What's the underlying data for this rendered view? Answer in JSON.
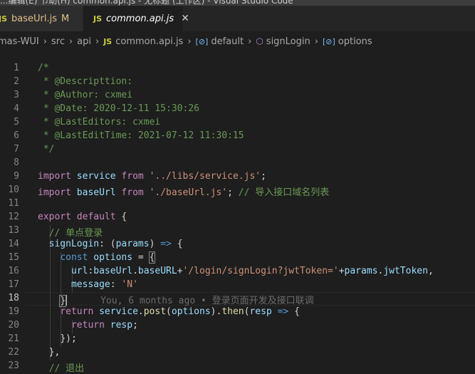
{
  "window": {
    "title_partial": "...编辑(E) 节助(H)    common.api.js - 无标题 (工作区) - Visual Studio Code"
  },
  "tabs": [
    {
      "icon": "JS",
      "label": "baseUrl.js",
      "status": "M"
    },
    {
      "icon": "JS",
      "label": "common.api.js",
      "close": "✕"
    }
  ],
  "breadcrumb": {
    "items": [
      "mas-WUI",
      "src",
      "api",
      "common.api.js",
      "default",
      "signLogin",
      "options"
    ],
    "js_icon": "JS",
    "obj_icon": "[⊘]",
    "method_icon": "⬡"
  },
  "editor": {
    "active_line": 18,
    "blame": "You, 6 months ago • 登录页面开发及接口联调",
    "lines": [
      {
        "n": "1",
        "t": "/*"
      },
      {
        "n": "2",
        "t": " * @Descripttion:"
      },
      {
        "n": "3",
        "t": " * @Author: cxmei"
      },
      {
        "n": "4",
        "t": " * @Date: 2020-12-11 15:30:26"
      },
      {
        "n": "5",
        "t": " * @LastEditors: cxmei"
      },
      {
        "n": "6",
        "t": " * @LastEditTime: 2021-07-12 11:30:15"
      },
      {
        "n": "7",
        "t": " */"
      },
      {
        "n": "8",
        "t": ""
      },
      {
        "n": "9",
        "t": "import service from '../libs/service.js';"
      },
      {
        "n": "10",
        "t": "import baseUrl from './baseUrl.js'; // 导入接口域名列表"
      },
      {
        "n": "11",
        "t": ""
      },
      {
        "n": "12",
        "t": "export default {"
      },
      {
        "n": "13",
        "t": "  // 单点登录"
      },
      {
        "n": "14",
        "t": "  signLogin: (params) => {"
      },
      {
        "n": "15",
        "t": "    const options = {"
      },
      {
        "n": "16",
        "t": "      url:baseUrl.baseURL+'/login/signLogin?jwtToken='+params.jwtToken,"
      },
      {
        "n": "17",
        "t": "      message: 'N'"
      },
      {
        "n": "18",
        "t": "    }"
      },
      {
        "n": "19",
        "t": "    return service.post(options).then(resp => {"
      },
      {
        "n": "20",
        "t": "      return resp;"
      },
      {
        "n": "21",
        "t": "    });"
      },
      {
        "n": "22",
        "t": "  },"
      },
      {
        "n": "23",
        "t": "  // 退出"
      }
    ]
  },
  "colors": {
    "keyword": "#c586c0",
    "string": "#ce9178",
    "comment": "#6a9955",
    "variable": "#9cdcfe",
    "function": "#dcdcaa",
    "storage": "#569cd6"
  }
}
